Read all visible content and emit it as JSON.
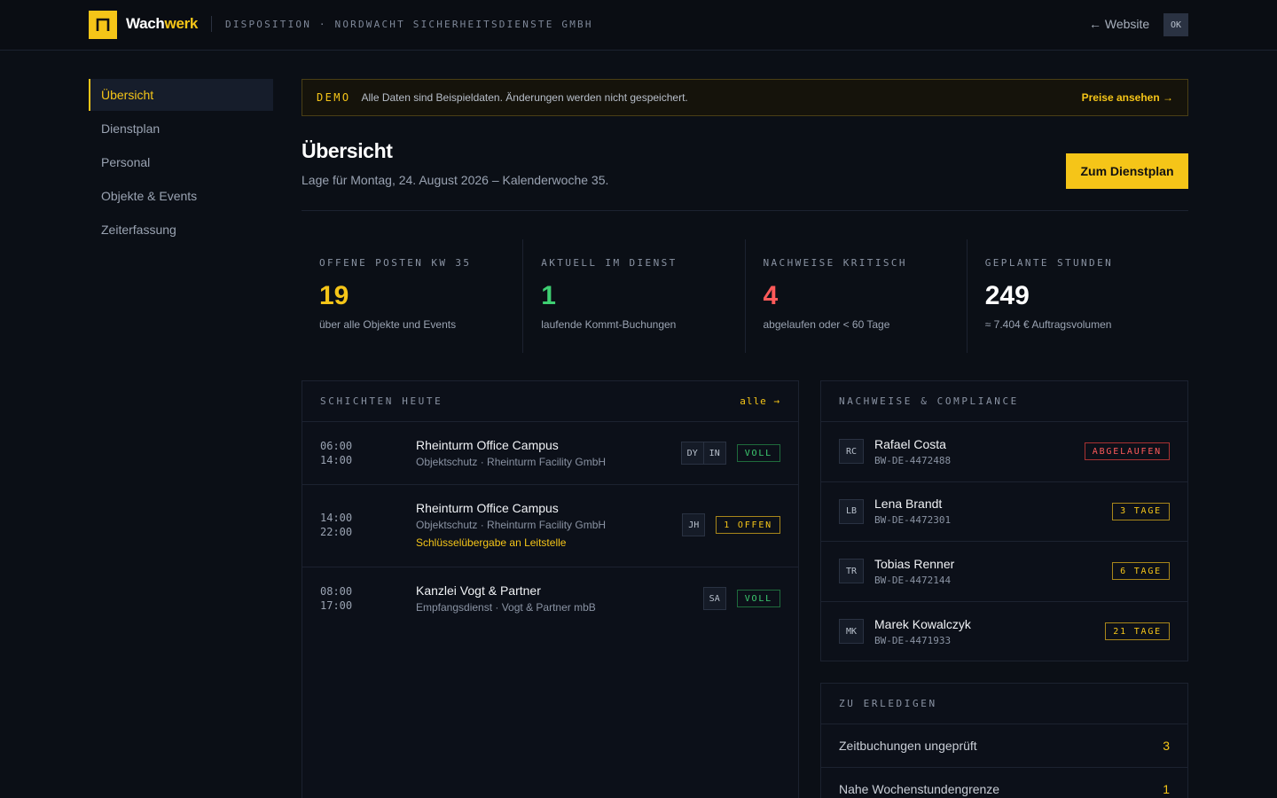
{
  "topbar": {
    "brand_part1": "Wach",
    "brand_part2": "werk",
    "context": "DISPOSITION · NORDWACHT SICHERHEITSDIENSTE GMBH",
    "website_link": "← Website",
    "user_initials": "OK"
  },
  "sidebar": {
    "items": [
      {
        "label": "Übersicht",
        "active": true
      },
      {
        "label": "Dienstplan"
      },
      {
        "label": "Personal"
      },
      {
        "label": "Objekte & Events"
      },
      {
        "label": "Zeiterfassung"
      }
    ]
  },
  "demo_banner": {
    "tag": "DEMO",
    "text": "Alle Daten sind Beispieldaten. Änderungen werden nicht gespeichert.",
    "link": "Preise ansehen →"
  },
  "header": {
    "title": "Übersicht",
    "subtitle": "Lage für Montag, 24. August 2026 – Kalenderwoche 35.",
    "cta": "Zum Dienstplan"
  },
  "stats": [
    {
      "label": "OFFENE POSTEN KW 35",
      "value": "19",
      "note": "über alle Objekte und Events",
      "color": "#f5c518"
    },
    {
      "label": "AKTUELL IM DIENST",
      "value": "1",
      "note": "laufende Kommt-Buchungen",
      "color": "#3ecf72"
    },
    {
      "label": "NACHWEISE KRITISCH",
      "value": "4",
      "note": "abgelaufen oder < 60 Tage",
      "color": "#ff5a5a"
    },
    {
      "label": "GEPLANTE STUNDEN",
      "value": "249",
      "note": "≈ 7.404 € Auftragsvolumen",
      "color": "#ffffff"
    }
  ],
  "shifts_panel": {
    "title": "SCHICHTEN HEUTE",
    "link": "alle →",
    "shifts": [
      {
        "start": "06:00",
        "end": "14:00",
        "name": "Rheinturm Office Campus",
        "sub": "Objektschutz · Rheinturm Facility GmbH",
        "note": "",
        "initials": [
          "DY",
          "IN"
        ],
        "badge": "VOLL",
        "badge_type": "ok"
      },
      {
        "start": "14:00",
        "end": "22:00",
        "name": "Rheinturm Office Campus",
        "sub": "Objektschutz · Rheinturm Facility GmbH",
        "note": "Schlüsselübergabe an Leitstelle",
        "initials": [
          "JH"
        ],
        "badge": "1 OFFEN",
        "badge_type": "warn"
      },
      {
        "start": "08:00",
        "end": "17:00",
        "name": "Kanzlei Vogt & Partner",
        "sub": "Empfangsdienst · Vogt & Partner mbB",
        "note": "",
        "initials": [
          "SA"
        ],
        "badge": "VOLL",
        "badge_type": "ok"
      }
    ]
  },
  "compliance_panel": {
    "title": "NACHWEISE & COMPLIANCE",
    "items": [
      {
        "initials": "RC",
        "name": "Rafael Costa",
        "id": "BW-DE-4472488",
        "badge": "ABGELAUFEN",
        "badge_type": "err"
      },
      {
        "initials": "LB",
        "name": "Lena Brandt",
        "id": "BW-DE-4472301",
        "badge": "3 TAGE",
        "badge_type": "warn"
      },
      {
        "initials": "TR",
        "name": "Tobias Renner",
        "id": "BW-DE-4472144",
        "badge": "6 TAGE",
        "badge_type": "warn"
      },
      {
        "initials": "MK",
        "name": "Marek Kowalczyk",
        "id": "BW-DE-4471933",
        "badge": "21 TAGE",
        "badge_type": "warn"
      }
    ]
  },
  "todo_panel": {
    "title": "ZU ERLEDIGEN",
    "items": [
      {
        "label": "Zeitbuchungen ungeprüft",
        "count": "3"
      },
      {
        "label": "Nahe Wochenstundengrenze",
        "count": "1"
      }
    ]
  }
}
